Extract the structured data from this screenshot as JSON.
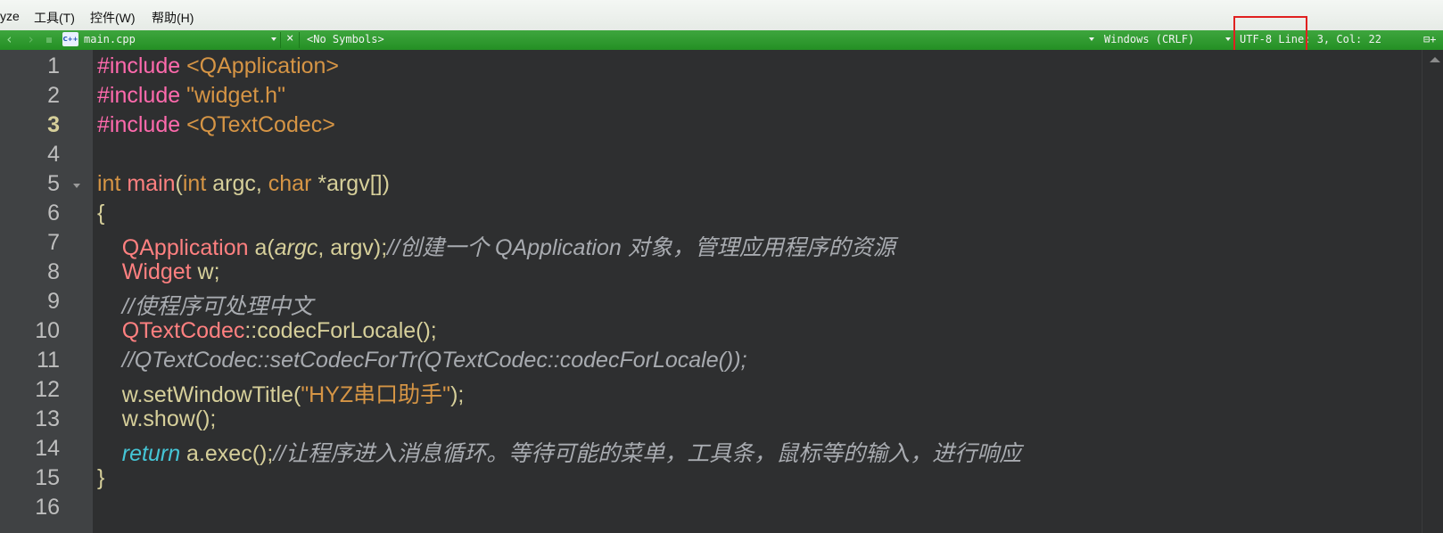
{
  "menu": {
    "partial": "yze",
    "tools": "工具(T)",
    "controls": "控件(W)",
    "help": "帮助(H)"
  },
  "toolbar": {
    "back": "‹",
    "forward": "›",
    "file_icon_text": "C++",
    "file_name": "main.cpp",
    "close": "×",
    "symbols": "<No Symbols>",
    "line_ending": "Windows (CRLF)",
    "encoding_position": "UTF-8 Line: 3, Col: 22",
    "split": "⊟+"
  },
  "editor": {
    "current_line": 3,
    "line_numbers": [
      "1",
      "2",
      "3",
      "4",
      "5",
      "6",
      "7",
      "8",
      "9",
      "10",
      "11",
      "12",
      "13",
      "14",
      "15",
      "16"
    ],
    "lines": [
      {
        "pp": "#include",
        "inc": " <QApplication>"
      },
      {
        "pp": "#include",
        "inc": " \"widget.h\""
      },
      {
        "pp": "#include",
        "inc": " <QTextCodec>"
      },
      {},
      {
        "kw1": "int",
        "sp1": " ",
        "fn": "main",
        "p1": "(",
        "kw2": "int",
        "p2": " argc, ",
        "kw3": "char",
        "p3": " *argv[])"
      },
      {
        "brace": "{"
      },
      {
        "indent": "    ",
        "cls": "QApplication",
        "p1": " a(",
        "it": "argc",
        "p2": ", argv);",
        "cm": "//创建一个 QApplication 对象，管理应用程序的资源"
      },
      {
        "indent": "    ",
        "cls": "Widget",
        "p1": " w;"
      },
      {
        "indent": "    ",
        "cm": "//使程序可处理中文"
      },
      {
        "indent": "    ",
        "cls": "QTextCodec",
        "op": "::",
        "p1": "codecForLocale();"
      },
      {
        "indent": "    ",
        "cm": "//QTextCodec::setCodecForTr(QTextCodec::codecForLocale());"
      },
      {
        "indent": "    ",
        "p1": "w.setWindowTitle(",
        "str": "\"HYZ串口助手\"",
        "p2": ");"
      },
      {
        "indent": "    ",
        "p1": "w.show();"
      },
      {
        "indent": "    ",
        "ret": "return",
        "p1": " a.exec();",
        "cm": "//让程序进入消息循环。等待可能的菜单，工具条，鼠标等的输入，进行响应"
      },
      {
        "brace": "}"
      },
      {}
    ]
  }
}
